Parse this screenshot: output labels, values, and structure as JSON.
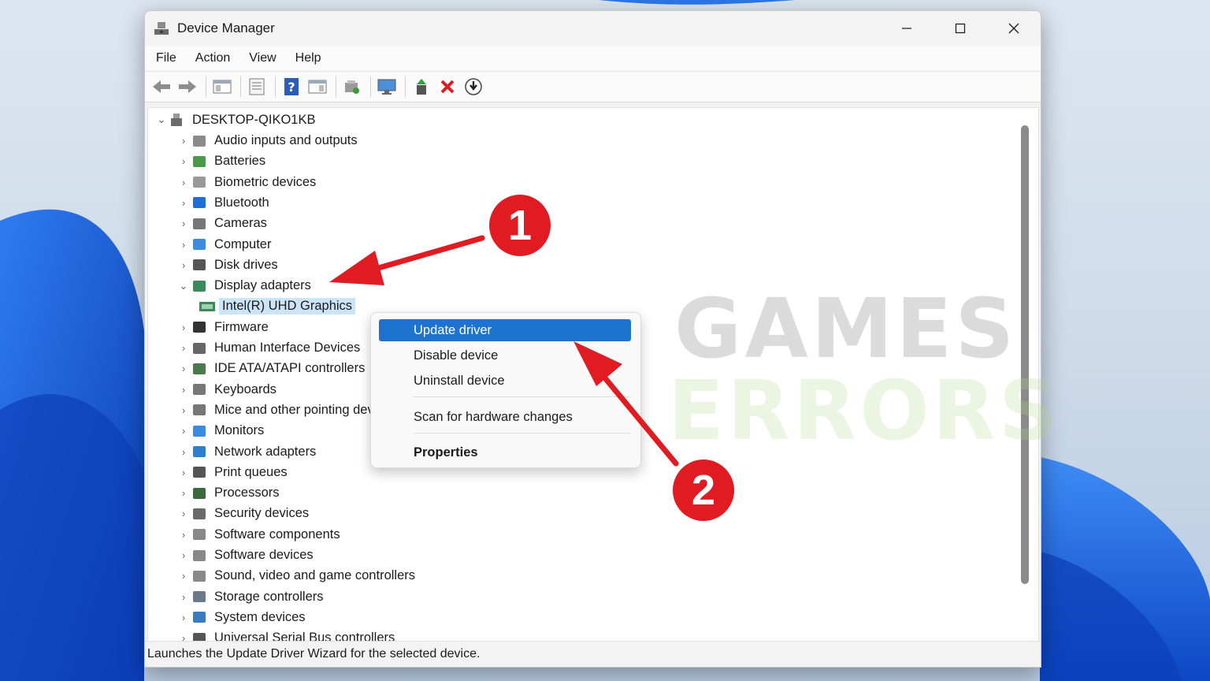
{
  "window": {
    "title": "Device Manager",
    "controls": {
      "minimize": "minimize",
      "maximize": "maximize",
      "close": "close"
    }
  },
  "menubar": [
    "File",
    "Action",
    "View",
    "Help"
  ],
  "toolbar": [
    "back-arrow-icon",
    "forward-arrow-icon",
    "console-tree-icon",
    "properties-icon",
    "help-icon",
    "action-pane-icon",
    "scan-hardware-icon",
    "monitor-icon",
    "add-driver-icon",
    "uninstall-x-icon",
    "download-icon"
  ],
  "tree": {
    "root": "DESKTOP-QIKO1KB",
    "categories": [
      {
        "label": "Audio inputs and outputs",
        "icon": "speaker-icon"
      },
      {
        "label": "Batteries",
        "icon": "battery-icon"
      },
      {
        "label": "Biometric devices",
        "icon": "fingerprint-icon"
      },
      {
        "label": "Bluetooth",
        "icon": "bluetooth-icon"
      },
      {
        "label": "Cameras",
        "icon": "camera-icon"
      },
      {
        "label": "Computer",
        "icon": "computer-icon"
      },
      {
        "label": "Disk drives",
        "icon": "disk-icon"
      },
      {
        "label": "Display adapters",
        "icon": "display-adapter-icon",
        "expanded": true
      },
      {
        "label": "Firmware",
        "icon": "firmware-icon"
      },
      {
        "label": "Human Interface Devices",
        "icon": "hid-icon"
      },
      {
        "label": "IDE ATA/ATAPI controllers",
        "icon": "ide-icon"
      },
      {
        "label": "Keyboards",
        "icon": "keyboard-icon"
      },
      {
        "label": "Mice and other pointing devices",
        "icon": "mouse-icon"
      },
      {
        "label": "Monitors",
        "icon": "monitor-icon"
      },
      {
        "label": "Network adapters",
        "icon": "network-icon"
      },
      {
        "label": "Print queues",
        "icon": "printer-icon"
      },
      {
        "label": "Processors",
        "icon": "processor-icon"
      },
      {
        "label": "Security devices",
        "icon": "security-icon"
      },
      {
        "label": "Software components",
        "icon": "software-component-icon"
      },
      {
        "label": "Software devices",
        "icon": "software-device-icon"
      },
      {
        "label": "Sound, video and game controllers",
        "icon": "sound-icon"
      },
      {
        "label": "Storage controllers",
        "icon": "storage-icon"
      },
      {
        "label": "System devices",
        "icon": "system-icon"
      },
      {
        "label": "Universal Serial Bus controllers",
        "icon": "usb-icon"
      }
    ],
    "selected_child": "Intel(R) UHD Graphics"
  },
  "context_menu": {
    "update_driver": "Update driver",
    "disable_device": "Disable device",
    "uninstall_device": "Uninstall device",
    "scan_hardware": "Scan for hardware changes",
    "properties": "Properties"
  },
  "statusbar": "Launches the Update Driver Wizard for the selected device.",
  "watermark": {
    "line1": "GAMES",
    "line2": "ERRORS"
  },
  "annotations": {
    "step1": "1",
    "step2": "2",
    "color": "#e01b22"
  },
  "colors": {
    "highlight": "#1e73cf",
    "selection": "#cce4f7"
  }
}
